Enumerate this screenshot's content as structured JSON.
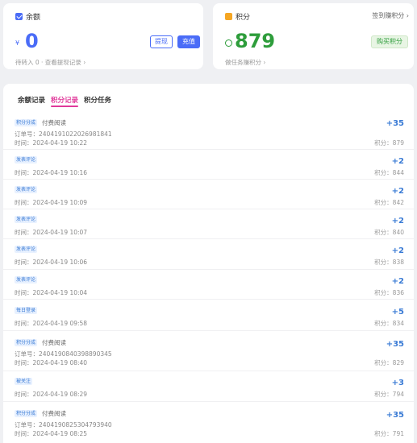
{
  "balance": {
    "title": "余额",
    "currency_symbol": "¥",
    "amount": "0",
    "pending_link": "待转入 0 · 查看提现记录 ›",
    "withdraw_label": "提现",
    "recharge_label": "充值"
  },
  "points": {
    "title": "积分",
    "sign_link": "签到赚积分 ›",
    "amount": "879",
    "task_link": "做任务赚积分 ›",
    "buy_label": "购买积分"
  },
  "tabs": [
    "余额记录",
    "积分记录",
    "积分任务"
  ],
  "records": [
    {
      "tag": "积分分成",
      "desc": "付费阅读",
      "order": "订单号：2404191022026981841",
      "time": "时间：2024-04-19 10:22",
      "delta": "+35",
      "after": "积分：879"
    },
    {
      "tag": "发表评论",
      "desc": "",
      "order": "",
      "time": "时间：2024-04-19 10:16",
      "delta": "+2",
      "after": "积分：844"
    },
    {
      "tag": "发表评论",
      "desc": "",
      "order": "",
      "time": "时间：2024-04-19 10:09",
      "delta": "+2",
      "after": "积分：842"
    },
    {
      "tag": "发表评论",
      "desc": "",
      "order": "",
      "time": "时间：2024-04-19 10:07",
      "delta": "+2",
      "after": "积分：840"
    },
    {
      "tag": "发表评论",
      "desc": "",
      "order": "",
      "time": "时间：2024-04-19 10:06",
      "delta": "+2",
      "after": "积分：838"
    },
    {
      "tag": "发表评论",
      "desc": "",
      "order": "",
      "time": "时间：2024-04-19 10:04",
      "delta": "+2",
      "after": "积分：836"
    },
    {
      "tag": "每日登录",
      "desc": "",
      "order": "",
      "time": "时间：2024-04-19 09:58",
      "delta": "+5",
      "after": "积分：834"
    },
    {
      "tag": "积分分成",
      "desc": "付费阅读",
      "order": "订单号：2404190840398890345",
      "time": "时间：2024-04-19 08:40",
      "delta": "+35",
      "after": "积分：829"
    },
    {
      "tag": "被关注",
      "desc": "",
      "order": "",
      "time": "时间：2024-04-19 08:29",
      "delta": "+3",
      "after": "积分：794"
    },
    {
      "tag": "积分分成",
      "desc": "付费阅读",
      "order": "订单号：2404190825304793940",
      "time": "时间：2024-04-19 08:25",
      "delta": "+35",
      "after": "积分：791"
    }
  ],
  "colors": {
    "accent": "#4a6cf7",
    "points_green": "#2e9d3b",
    "tab_active": "#e0399a",
    "tag_blue": "#3a7bd5"
  }
}
